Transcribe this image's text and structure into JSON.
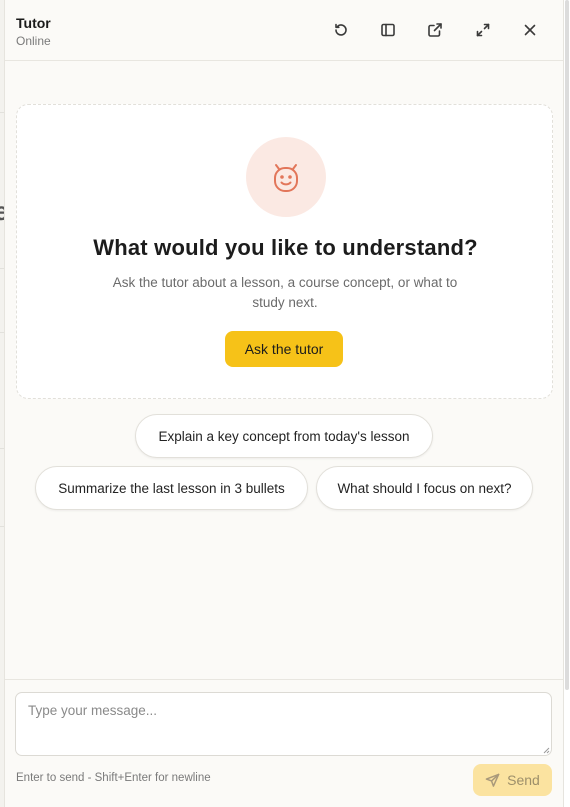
{
  "header": {
    "title": "Tutor",
    "status": "Online",
    "actions": [
      {
        "name": "refresh-icon"
      },
      {
        "name": "sidebar-toggle-icon"
      },
      {
        "name": "external-link-icon"
      },
      {
        "name": "expand-icon"
      },
      {
        "name": "close-icon"
      }
    ]
  },
  "welcome": {
    "avatar_icon": "smiling-face-icon",
    "title": "What would you like to understand?",
    "subtitle": "Ask the tutor about a lesson, a course concept, or what to study next.",
    "cta_label": "Ask the tutor"
  },
  "suggestions": [
    "Explain a key concept from today's lesson",
    "Summarize the last lesson in 3 bullets",
    "What should I focus on next?"
  ],
  "composer": {
    "placeholder": "Type your message...",
    "value": "",
    "hint": "Enter to send - Shift+Enter for newline",
    "send_label": "Send"
  },
  "colors": {
    "accent": "#f6c218",
    "send_disabled_bg": "#fbe3a0",
    "avatar_bg": "#fbe9e3",
    "avatar_stroke": "#e2765a"
  }
}
